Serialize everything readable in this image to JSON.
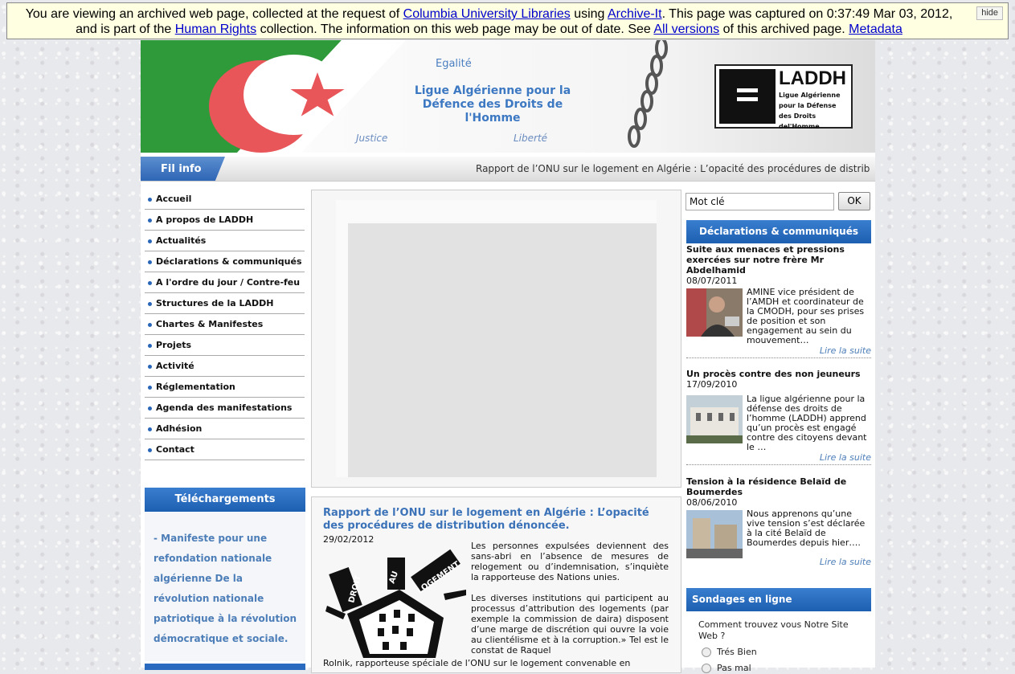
{
  "banner": {
    "text_1": "You are viewing an archived web page, collected at the request of",
    "link_columbia": "Columbia University Libraries",
    "text_2": "using",
    "link_archiveit": "Archive-It",
    "text_3": ". This page was captured on 0:37:49 Mar 03, 2012, and is part of the",
    "link_humanrights": "Human Rights",
    "text_4": "collection. The information on this web page may be out of date. See",
    "link_allversions": "All versions",
    "text_5": "of this archived page.",
    "link_metadata": "Metadata",
    "hide": "hide"
  },
  "header": {
    "egalite": "Egalité",
    "title": "Ligue Algérienne pour la Défence des Droits de l'Homme",
    "justice": "Justice",
    "liberte": "Liberté",
    "logo_big": "LADDH",
    "logo_small": "Ligue Algérienne pour la Défense des Droits del'Homme"
  },
  "filinfo": {
    "label": "Fil info",
    "ticker": "Rapport de l’ONU sur le logement en Algérie : L’opacité des procédures de distribution dénoncée."
  },
  "nav": [
    {
      "label": "Accueil"
    },
    {
      "label": "A propos de LADDH"
    },
    {
      "label": "Actualités"
    },
    {
      "label": "Déclarations & communiqués"
    },
    {
      "label": "A l'ordre du jour / Contre-feu"
    },
    {
      "label": "Structures de la LADDH"
    },
    {
      "label": "Chartes & Manifestes"
    },
    {
      "label": "Projets"
    },
    {
      "label": "Activité"
    },
    {
      "label": "Réglementation"
    },
    {
      "label": "Agenda des manifestations"
    },
    {
      "label": "Adhésion"
    },
    {
      "label": "Contact"
    }
  ],
  "downloads": {
    "title": "Téléchargements",
    "link": "- Manifeste pour une refondation nationale algérienne De la révolution nationale patriotique à la révolution démocratique et sociale."
  },
  "article": {
    "title": "Rapport de l’ONU sur le logement en Algérie : L’opacité des procédures de distribution dénoncée.",
    "date": "29/02/2012",
    "image_words": [
      "DROIT",
      "AU",
      "LOGEMENT"
    ],
    "p1": "Les personnes expulsées deviennent des sans-abri en l’absence de mesures de relogement ou d’indemnisation, s’inquiète la rapporteuse des Nations unies.",
    "p2": "Les diverses institutions qui participent au processus d’attribution des logements (par exemple la commission de daira) disposent d’une marge de discrétion qui ouvre la voie au clientélisme et à la corruption.» Tel est le constat de Raquel",
    "p3": "Rolnik, rapporteuse spéciale de l’ONU sur le logement convenable en"
  },
  "search": {
    "value": "Mot clé",
    "button": "OK"
  },
  "declarations": {
    "title": "Déclarations & communiqués",
    "items": [
      {
        "title": "Suite aux menaces et pressions exercées sur notre frère Mr Abdelhamid",
        "date": "08/07/2011",
        "text": "AMINE vice président de l’AMDH et coordinateur de la CMODH, pour ses prises de position et son engagement au sein du mouvement…",
        "more": "Lire la suite"
      },
      {
        "title": "Un procès contre des non jeuneurs",
        "date": "17/09/2010",
        "text": "La ligue algérienne pour la défense des droits de l’homme (LADDH) apprend qu’un procès est engagé contre des citoyens devant le …",
        "more": "Lire la suite"
      },
      {
        "title": "Tension à la résidence Belaïd de Boumerdes",
        "date": "08/06/2010",
        "text": "Nous apprenons qu’une vive tension s’est déclarée à la cité Belaïd de Boumerdes depuis hier….",
        "more": "Lire la suite"
      }
    ]
  },
  "polls": {
    "title": "Sondages en ligne",
    "question": "Comment trouvez vous Notre Site Web ?",
    "options": [
      "Trés Bien",
      "Pas mal"
    ]
  }
}
